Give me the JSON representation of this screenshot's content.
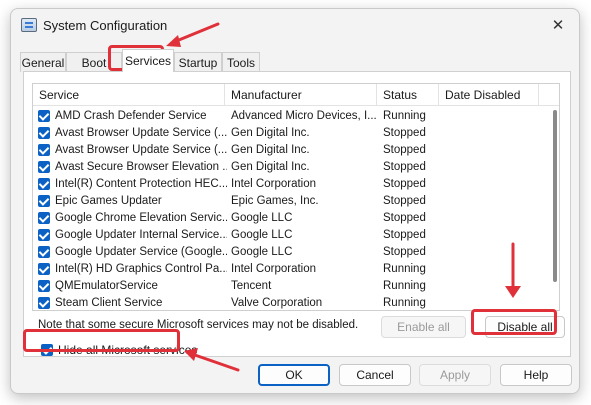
{
  "window": {
    "title": "System Configuration"
  },
  "tabs": [
    {
      "label": "General"
    },
    {
      "label": "Boot"
    },
    {
      "label": "Services"
    },
    {
      "label": "Startup"
    },
    {
      "label": "Tools"
    }
  ],
  "list": {
    "columns": [
      "Service",
      "Manufacturer",
      "Status",
      "Date Disabled"
    ],
    "rows": [
      {
        "service": "AMD Crash Defender Service",
        "manufacturer": "Advanced Micro Devices, I...",
        "status": "Running",
        "checked": true
      },
      {
        "service": "Avast Browser Update Service (...",
        "manufacturer": "Gen Digital Inc.",
        "status": "Stopped",
        "checked": true
      },
      {
        "service": "Avast Browser Update Service (...",
        "manufacturer": "Gen Digital Inc.",
        "status": "Stopped",
        "checked": true
      },
      {
        "service": "Avast Secure Browser Elevation ...",
        "manufacturer": "Gen Digital Inc.",
        "status": "Stopped",
        "checked": true
      },
      {
        "service": "Intel(R) Content Protection HEC...",
        "manufacturer": "Intel Corporation",
        "status": "Stopped",
        "checked": true
      },
      {
        "service": "Epic Games Updater",
        "manufacturer": "Epic Games, Inc.",
        "status": "Stopped",
        "checked": true
      },
      {
        "service": "Google Chrome Elevation Servic...",
        "manufacturer": "Google LLC",
        "status": "Stopped",
        "checked": true
      },
      {
        "service": "Google Updater Internal Service...",
        "manufacturer": "Google LLC",
        "status": "Stopped",
        "checked": true
      },
      {
        "service": "Google Updater Service (Google...",
        "manufacturer": "Google LLC",
        "status": "Stopped",
        "checked": true
      },
      {
        "service": "Intel(R) HD Graphics Control Pa...",
        "manufacturer": "Intel Corporation",
        "status": "Running",
        "checked": true
      },
      {
        "service": "QMEmulatorService",
        "manufacturer": "Tencent",
        "status": "Running",
        "checked": true
      },
      {
        "service": "Steam Client Service",
        "manufacturer": "Valve Corporation",
        "status": "Running",
        "checked": true
      }
    ]
  },
  "note": "Note that some secure Microsoft services may not be disabled.",
  "buttons": {
    "enable_all": "Enable all",
    "disable_all": "Disable all",
    "ok": "OK",
    "cancel": "Cancel",
    "apply": "Apply",
    "help": "Help"
  },
  "hide_ms": {
    "label": "Hide all Microsoft services",
    "checked": true
  },
  "colors": {
    "accent": "#0b62c4",
    "highlight": "#e0303a"
  }
}
